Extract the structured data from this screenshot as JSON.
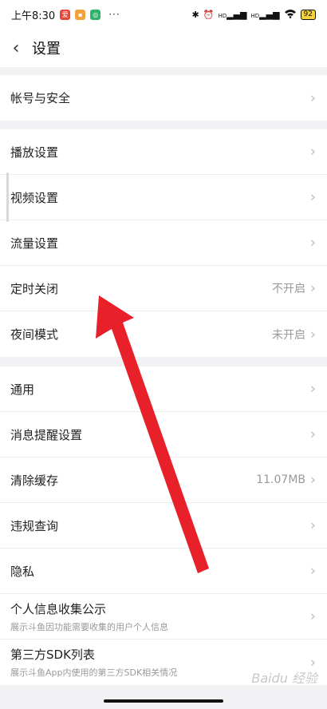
{
  "status_bar": {
    "time": "上午8:30",
    "app_icon_1": "爱",
    "app_icon_3": "◎",
    "dots": "···",
    "signal_1": "HD",
    "signal_2": "HD",
    "battery": "92"
  },
  "header": {
    "title": "设置",
    "back_glyph": "‹"
  },
  "groups": {
    "account": {
      "label": "帐号与安全"
    },
    "play": [
      {
        "label": "播放设置",
        "value": ""
      },
      {
        "label": "视频设置",
        "value": ""
      },
      {
        "label": "流量设置",
        "value": ""
      },
      {
        "label": "定时关闭",
        "value": "不开启"
      },
      {
        "label": "夜间模式",
        "value": "未开启"
      }
    ],
    "general": [
      {
        "label": "通用",
        "value": ""
      },
      {
        "label": "消息提醒设置",
        "value": ""
      },
      {
        "label": "清除缓存",
        "value": "11.07MB"
      },
      {
        "label": "违规查询",
        "value": ""
      },
      {
        "label": "隐私",
        "value": ""
      }
    ],
    "info": [
      {
        "label": "个人信息收集公示",
        "desc": "展示斗鱼因功能需要收集的用户个人信息"
      },
      {
        "label": "第三方SDK列表",
        "desc": "展示斗鱼App内使用的第三方SDK相关情况"
      }
    ]
  },
  "watermark": "Baidu 经验",
  "colors": {
    "arrow": "#e8202a",
    "chevron": "#bbbbbb",
    "value_text": "#999999"
  }
}
